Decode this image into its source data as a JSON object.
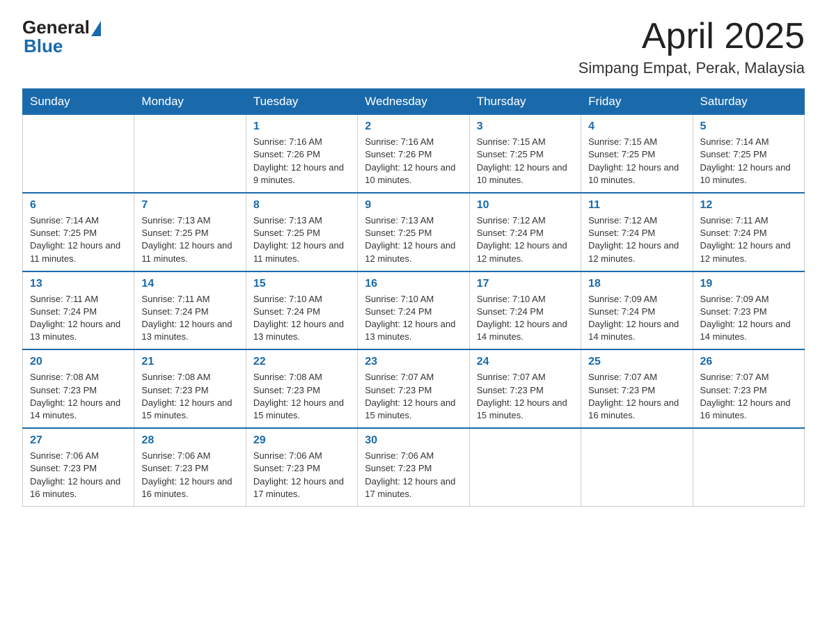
{
  "header": {
    "logo_general": "General",
    "logo_blue": "Blue",
    "title": "April 2025",
    "subtitle": "Simpang Empat, Perak, Malaysia"
  },
  "weekdays": [
    "Sunday",
    "Monday",
    "Tuesday",
    "Wednesday",
    "Thursday",
    "Friday",
    "Saturday"
  ],
  "weeks": [
    [
      {
        "day": "",
        "sunrise": "",
        "sunset": "",
        "daylight": ""
      },
      {
        "day": "",
        "sunrise": "",
        "sunset": "",
        "daylight": ""
      },
      {
        "day": "1",
        "sunrise": "Sunrise: 7:16 AM",
        "sunset": "Sunset: 7:26 PM",
        "daylight": "Daylight: 12 hours and 9 minutes."
      },
      {
        "day": "2",
        "sunrise": "Sunrise: 7:16 AM",
        "sunset": "Sunset: 7:26 PM",
        "daylight": "Daylight: 12 hours and 10 minutes."
      },
      {
        "day": "3",
        "sunrise": "Sunrise: 7:15 AM",
        "sunset": "Sunset: 7:25 PM",
        "daylight": "Daylight: 12 hours and 10 minutes."
      },
      {
        "day": "4",
        "sunrise": "Sunrise: 7:15 AM",
        "sunset": "Sunset: 7:25 PM",
        "daylight": "Daylight: 12 hours and 10 minutes."
      },
      {
        "day": "5",
        "sunrise": "Sunrise: 7:14 AM",
        "sunset": "Sunset: 7:25 PM",
        "daylight": "Daylight: 12 hours and 10 minutes."
      }
    ],
    [
      {
        "day": "6",
        "sunrise": "Sunrise: 7:14 AM",
        "sunset": "Sunset: 7:25 PM",
        "daylight": "Daylight: 12 hours and 11 minutes."
      },
      {
        "day": "7",
        "sunrise": "Sunrise: 7:13 AM",
        "sunset": "Sunset: 7:25 PM",
        "daylight": "Daylight: 12 hours and 11 minutes."
      },
      {
        "day": "8",
        "sunrise": "Sunrise: 7:13 AM",
        "sunset": "Sunset: 7:25 PM",
        "daylight": "Daylight: 12 hours and 11 minutes."
      },
      {
        "day": "9",
        "sunrise": "Sunrise: 7:13 AM",
        "sunset": "Sunset: 7:25 PM",
        "daylight": "Daylight: 12 hours and 12 minutes."
      },
      {
        "day": "10",
        "sunrise": "Sunrise: 7:12 AM",
        "sunset": "Sunset: 7:24 PM",
        "daylight": "Daylight: 12 hours and 12 minutes."
      },
      {
        "day": "11",
        "sunrise": "Sunrise: 7:12 AM",
        "sunset": "Sunset: 7:24 PM",
        "daylight": "Daylight: 12 hours and 12 minutes."
      },
      {
        "day": "12",
        "sunrise": "Sunrise: 7:11 AM",
        "sunset": "Sunset: 7:24 PM",
        "daylight": "Daylight: 12 hours and 12 minutes."
      }
    ],
    [
      {
        "day": "13",
        "sunrise": "Sunrise: 7:11 AM",
        "sunset": "Sunset: 7:24 PM",
        "daylight": "Daylight: 12 hours and 13 minutes."
      },
      {
        "day": "14",
        "sunrise": "Sunrise: 7:11 AM",
        "sunset": "Sunset: 7:24 PM",
        "daylight": "Daylight: 12 hours and 13 minutes."
      },
      {
        "day": "15",
        "sunrise": "Sunrise: 7:10 AM",
        "sunset": "Sunset: 7:24 PM",
        "daylight": "Daylight: 12 hours and 13 minutes."
      },
      {
        "day": "16",
        "sunrise": "Sunrise: 7:10 AM",
        "sunset": "Sunset: 7:24 PM",
        "daylight": "Daylight: 12 hours and 13 minutes."
      },
      {
        "day": "17",
        "sunrise": "Sunrise: 7:10 AM",
        "sunset": "Sunset: 7:24 PM",
        "daylight": "Daylight: 12 hours and 14 minutes."
      },
      {
        "day": "18",
        "sunrise": "Sunrise: 7:09 AM",
        "sunset": "Sunset: 7:24 PM",
        "daylight": "Daylight: 12 hours and 14 minutes."
      },
      {
        "day": "19",
        "sunrise": "Sunrise: 7:09 AM",
        "sunset": "Sunset: 7:23 PM",
        "daylight": "Daylight: 12 hours and 14 minutes."
      }
    ],
    [
      {
        "day": "20",
        "sunrise": "Sunrise: 7:08 AM",
        "sunset": "Sunset: 7:23 PM",
        "daylight": "Daylight: 12 hours and 14 minutes."
      },
      {
        "day": "21",
        "sunrise": "Sunrise: 7:08 AM",
        "sunset": "Sunset: 7:23 PM",
        "daylight": "Daylight: 12 hours and 15 minutes."
      },
      {
        "day": "22",
        "sunrise": "Sunrise: 7:08 AM",
        "sunset": "Sunset: 7:23 PM",
        "daylight": "Daylight: 12 hours and 15 minutes."
      },
      {
        "day": "23",
        "sunrise": "Sunrise: 7:07 AM",
        "sunset": "Sunset: 7:23 PM",
        "daylight": "Daylight: 12 hours and 15 minutes."
      },
      {
        "day": "24",
        "sunrise": "Sunrise: 7:07 AM",
        "sunset": "Sunset: 7:23 PM",
        "daylight": "Daylight: 12 hours and 15 minutes."
      },
      {
        "day": "25",
        "sunrise": "Sunrise: 7:07 AM",
        "sunset": "Sunset: 7:23 PM",
        "daylight": "Daylight: 12 hours and 16 minutes."
      },
      {
        "day": "26",
        "sunrise": "Sunrise: 7:07 AM",
        "sunset": "Sunset: 7:23 PM",
        "daylight": "Daylight: 12 hours and 16 minutes."
      }
    ],
    [
      {
        "day": "27",
        "sunrise": "Sunrise: 7:06 AM",
        "sunset": "Sunset: 7:23 PM",
        "daylight": "Daylight: 12 hours and 16 minutes."
      },
      {
        "day": "28",
        "sunrise": "Sunrise: 7:06 AM",
        "sunset": "Sunset: 7:23 PM",
        "daylight": "Daylight: 12 hours and 16 minutes."
      },
      {
        "day": "29",
        "sunrise": "Sunrise: 7:06 AM",
        "sunset": "Sunset: 7:23 PM",
        "daylight": "Daylight: 12 hours and 17 minutes."
      },
      {
        "day": "30",
        "sunrise": "Sunrise: 7:06 AM",
        "sunset": "Sunset: 7:23 PM",
        "daylight": "Daylight: 12 hours and 17 minutes."
      },
      {
        "day": "",
        "sunrise": "",
        "sunset": "",
        "daylight": ""
      },
      {
        "day": "",
        "sunrise": "",
        "sunset": "",
        "daylight": ""
      },
      {
        "day": "",
        "sunrise": "",
        "sunset": "",
        "daylight": ""
      }
    ]
  ]
}
